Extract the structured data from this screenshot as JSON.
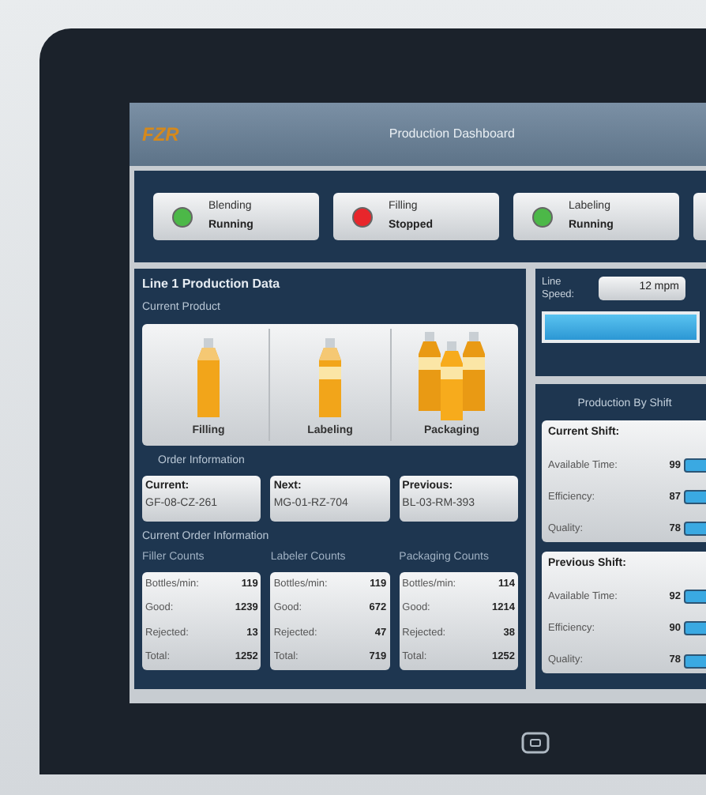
{
  "window": {
    "logo": "FZR",
    "title": "Production Dashboard"
  },
  "machines": [
    {
      "name": "Blending",
      "status": "Running",
      "color": "#4cb848"
    },
    {
      "name": "Filling",
      "status": "Stopped",
      "color": "#e8262b"
    },
    {
      "name": "Labeling",
      "status": "Running",
      "color": "#4cb848"
    }
  ],
  "production": {
    "title": "Line 1 Production Data",
    "current_product_label": "Current Product",
    "stages": [
      {
        "kind": "single",
        "label": "Filling"
      },
      {
        "kind": "single",
        "label": "Labeling"
      },
      {
        "kind": "pack",
        "label": "Packaging"
      }
    ],
    "order_label": "Order Information",
    "orders": [
      {
        "label": "Current:",
        "value": "GF-08-CZ-261"
      },
      {
        "label": "Next:",
        "value": "MG-01-RZ-704"
      },
      {
        "label": "Previous:",
        "value": "BL-03-RM-393"
      }
    ],
    "counts_label": "Current Order Information",
    "counts": [
      {
        "title": "Filler Counts",
        "rows": [
          {
            "label": "Bottles/min:",
            "value": "119"
          },
          {
            "label": "Good:",
            "value": "1239"
          },
          {
            "label": "Rejected:",
            "value": "13"
          },
          {
            "label": "Total:",
            "value": "1252"
          }
        ]
      },
      {
        "title": "Labeler Counts",
        "rows": [
          {
            "label": "Bottles/min:",
            "value": "119"
          },
          {
            "label": "Good:",
            "value": "672"
          },
          {
            "label": "Rejected:",
            "value": "47"
          },
          {
            "label": "Total:",
            "value": "719"
          }
        ]
      },
      {
        "title": "Packaging Counts",
        "rows": [
          {
            "label": "Bottles/min:",
            "value": "114"
          },
          {
            "label": "Good:",
            "value": "1214"
          },
          {
            "label": "Rejected:",
            "value": "38"
          },
          {
            "label": "Total:",
            "value": "1252"
          }
        ]
      }
    ]
  },
  "line_speed": {
    "label": "Line Speed:",
    "value": "12 mpm",
    "level": 1
  },
  "shifts": {
    "title": "Production By Shift",
    "groups": [
      {
        "title": "Current Shift:",
        "rows": [
          {
            "label": "Available Time:",
            "value": "99"
          },
          {
            "label": "Efficiency:",
            "value": "87"
          },
          {
            "label": "Quality:",
            "value": "78"
          }
        ]
      },
      {
        "title": "Previous Shift:",
        "rows": [
          {
            "label": "Available Time:",
            "value": "92"
          },
          {
            "label": "Efficiency:",
            "value": "90"
          },
          {
            "label": "Quality:",
            "value": "78"
          }
        ]
      }
    ]
  }
}
